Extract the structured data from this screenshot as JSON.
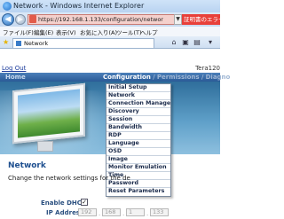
{
  "window": {
    "title": "Network - Windows Internet Explorer"
  },
  "addressbar": {
    "url": "https://192.168.1.133/configuration/networ",
    "cert_error": "証明書のエラー"
  },
  "menubar": {
    "items": [
      "ファイル(F)",
      "編集(E)",
      "表示(V)",
      "お気に入り(A)",
      "ツール(T)",
      "ヘルプ"
    ]
  },
  "tab": {
    "label": "Network"
  },
  "page": {
    "logout_label": "Log Out",
    "device_name": "Tera120",
    "home_label": "Home",
    "breadcrumb": {
      "active": "Configuration",
      "sep": "/",
      "permissions": "Permissions",
      "diagnostics": "Diagno"
    },
    "dropdown_items": [
      "Initial Setup",
      "Network",
      "Connection Management",
      "Discovery",
      "Session",
      "Bandwidth",
      "RDP",
      "Language",
      "OSD",
      "Image",
      "Monitor Emulation",
      "Time",
      "Password",
      "Reset Parameters"
    ],
    "section_title": "Network",
    "section_desc": "Change the network settings for the de",
    "dhcp_label": "Enable DHCP:",
    "dhcp_checked": "✓",
    "ip_label": "IP Address:",
    "ip_octets": [
      "192",
      "168",
      "1",
      "133"
    ]
  },
  "colors": {
    "blue_bar": "#2a5a96",
    "section_title": "#1e4f8f",
    "cert_error": "#e8403a"
  }
}
